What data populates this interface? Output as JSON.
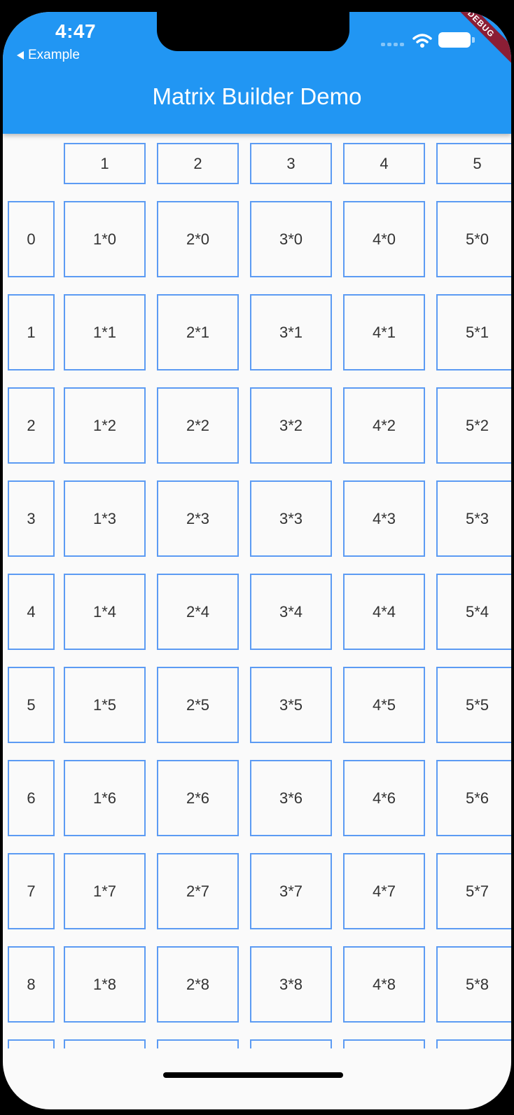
{
  "status_bar": {
    "time": "4:47",
    "back_app": "Example",
    "debug_banner": "DEBUG"
  },
  "app_bar": {
    "title": "Matrix Builder Demo",
    "color": "#2196f3"
  },
  "matrix": {
    "column_headers": [
      "1",
      "2",
      "3",
      "4",
      "5"
    ],
    "row_headers": [
      "0",
      "1",
      "2",
      "3",
      "4",
      "5",
      "6",
      "7",
      "8"
    ],
    "cells": [
      [
        "1*0",
        "2*0",
        "3*0",
        "4*0",
        "5*0"
      ],
      [
        "1*1",
        "2*1",
        "3*1",
        "4*1",
        "5*1"
      ],
      [
        "1*2",
        "2*2",
        "3*2",
        "4*2",
        "5*2"
      ],
      [
        "1*3",
        "2*3",
        "3*3",
        "4*3",
        "5*3"
      ],
      [
        "1*4",
        "2*4",
        "3*4",
        "4*4",
        "5*4"
      ],
      [
        "1*5",
        "2*5",
        "3*5",
        "4*5",
        "5*5"
      ],
      [
        "1*6",
        "2*6",
        "3*6",
        "4*6",
        "5*6"
      ],
      [
        "1*7",
        "2*7",
        "3*7",
        "4*7",
        "5*7"
      ],
      [
        "1*8",
        "2*8",
        "3*8",
        "4*8",
        "5*8"
      ]
    ],
    "border_color": "#5c9bf3"
  }
}
